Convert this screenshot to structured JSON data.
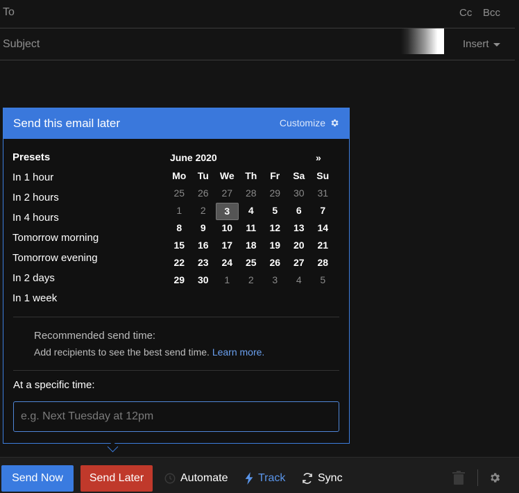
{
  "compose": {
    "to_label": "To",
    "cc_label": "Cc",
    "bcc_label": "Bcc",
    "subject_label": "Subject",
    "insert_label": "Insert"
  },
  "popup": {
    "title": "Send this email later",
    "customize_label": "Customize",
    "presets": {
      "heading": "Presets",
      "items": [
        "In 1 hour",
        "In 2 hours",
        "In 4 hours",
        "Tomorrow morning",
        "Tomorrow evening",
        "In 2 days",
        "In 1 week"
      ]
    },
    "calendar": {
      "month_label": "June 2020",
      "next_label": "»",
      "weekdays": [
        "Mo",
        "Tu",
        "We",
        "Th",
        "Fr",
        "Sa",
        "Su"
      ],
      "weeks": [
        [
          "25",
          "26",
          "27",
          "28",
          "29",
          "30",
          "31"
        ],
        [
          "1",
          "2",
          "3",
          "4",
          "5",
          "6",
          "7"
        ],
        [
          "8",
          "9",
          "10",
          "11",
          "12",
          "13",
          "14"
        ],
        [
          "15",
          "16",
          "17",
          "18",
          "19",
          "20",
          "21"
        ],
        [
          "22",
          "23",
          "24",
          "25",
          "26",
          "27",
          "28"
        ],
        [
          "29",
          "30",
          "1",
          "2",
          "3",
          "4",
          "5"
        ]
      ],
      "selected_day": "3"
    },
    "recommended": {
      "title": "Recommended send time:",
      "description": "Add recipients to see the best send time.",
      "link": "Learn more."
    },
    "specific_time": {
      "label": "At a specific time:",
      "placeholder": "e.g. Next Tuesday at 12pm",
      "value": ""
    }
  },
  "toolbar": {
    "send_now_label": "Send Now",
    "send_later_label": "Send Later",
    "automate_label": "Automate",
    "track_label": "Track",
    "sync_label": "Sync"
  },
  "colors": {
    "primary": "#3a7be0",
    "send_later": "#c0392b",
    "link": "#6aa0ef",
    "background": "#141414"
  },
  "icons": {
    "customize": "gear-icon",
    "automate": "clock-icon",
    "track": "lightning-icon",
    "sync": "sync-icon",
    "trash": "trash-icon",
    "settings": "gear-icon"
  }
}
